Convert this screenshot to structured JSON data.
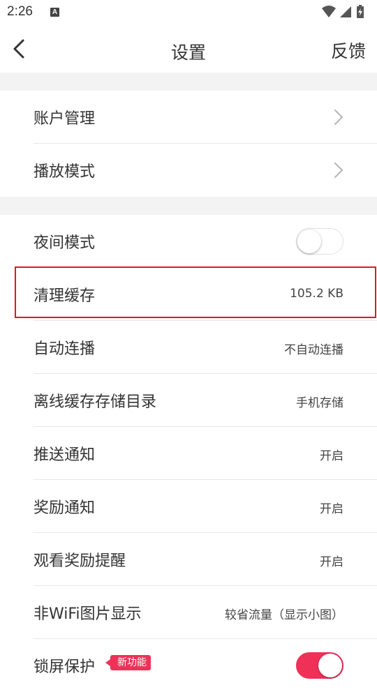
{
  "status": {
    "time": "2:26",
    "notification_icon": "a-icon"
  },
  "header": {
    "title": "设置",
    "back_icon": "chevron-left-icon",
    "feedback_label": "反馈"
  },
  "group1": [
    {
      "label": "账户管理",
      "icon": "chevron-right-icon"
    },
    {
      "label": "播放模式",
      "icon": "chevron-right-icon"
    }
  ],
  "group2": {
    "night_mode": {
      "label": "夜间模式",
      "enabled": false
    },
    "clear_cache": {
      "label": "清理缓存",
      "value": "105.2 KB"
    },
    "autoplay": {
      "label": "自动连播",
      "value": "不自动连播"
    },
    "offline_dir": {
      "label": "离线缓存存储目录",
      "value": "手机存储"
    },
    "push": {
      "label": "推送通知",
      "value": "开启"
    },
    "reward": {
      "label": "奖励通知",
      "value": "开启"
    },
    "reward_remind": {
      "label": "观看奖励提醒",
      "value": "开启"
    },
    "non_wifi_images": {
      "label": "非WiFi图片显示",
      "value": "较省流量（显示小图）"
    },
    "lock_screen": {
      "label": "锁屏保护",
      "badge": "新功能",
      "enabled": true
    }
  },
  "colors": {
    "accent": "#ef3158",
    "highlight_border": "#e21919",
    "separator": "#f3f3f3"
  }
}
